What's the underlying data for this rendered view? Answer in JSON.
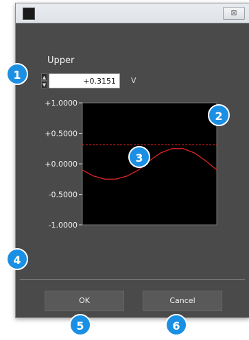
{
  "window": {
    "close_glyph": "⊠"
  },
  "editor": {
    "label": "Upper",
    "value": "+0.3151",
    "unit": "V",
    "spin_up": "▲",
    "spin_down": "▼"
  },
  "chart_data": {
    "type": "line",
    "yticks": [
      "+1.0000",
      "+0.5000",
      "+0.0000",
      "-0.5000",
      "-1.0000"
    ],
    "ylim": [
      -1.0,
      1.0
    ],
    "threshold": 0.3151,
    "series": [
      {
        "values": [
          -0.1,
          -0.2,
          -0.25,
          -0.25,
          -0.2,
          -0.1,
          0.05,
          0.18,
          0.25,
          0.25,
          0.18,
          0.05,
          -0.1
        ]
      }
    ],
    "colors": {
      "background": "#000000",
      "line": "#e02424",
      "threshold": "#e02424"
    }
  },
  "buttons": {
    "ok": "OK",
    "cancel": "Cancel"
  },
  "callouts": [
    "1",
    "2",
    "3",
    "4",
    "5",
    "6"
  ]
}
